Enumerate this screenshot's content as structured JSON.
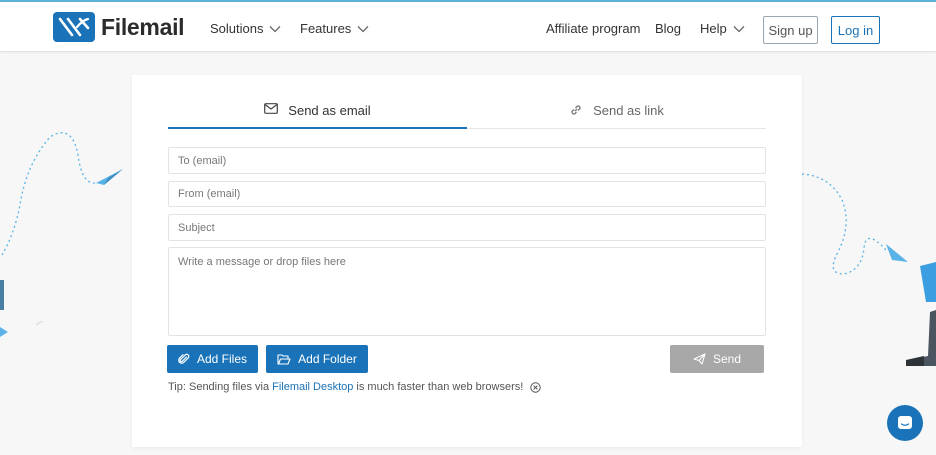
{
  "header": {
    "brand": "Filemail",
    "nav": [
      {
        "label": "Solutions"
      },
      {
        "label": "Features"
      },
      {
        "label": "Affiliate program"
      },
      {
        "label": "Blog"
      },
      {
        "label": "Help"
      }
    ],
    "signup_label": "Sign up",
    "login_label": "Log in"
  },
  "tabs": {
    "email_label": "Send as email",
    "link_label": "Send as link"
  },
  "form": {
    "to_placeholder": "To (email)",
    "from_placeholder": "From (email)",
    "subject_placeholder": "Subject",
    "message_placeholder": "Write a message or drop files here",
    "add_files_label": "Add Files",
    "add_folder_label": "Add Folder",
    "send_label": "Send"
  },
  "tip": {
    "prefix": "Tip: Sending files via",
    "link": "Filemail Desktop",
    "suffix": "is much faster than web browsers!"
  },
  "colors": {
    "brand": "#1a73b8",
    "send_disabled": "#a8a8a8",
    "deco_blue": "#5ab3e6"
  }
}
